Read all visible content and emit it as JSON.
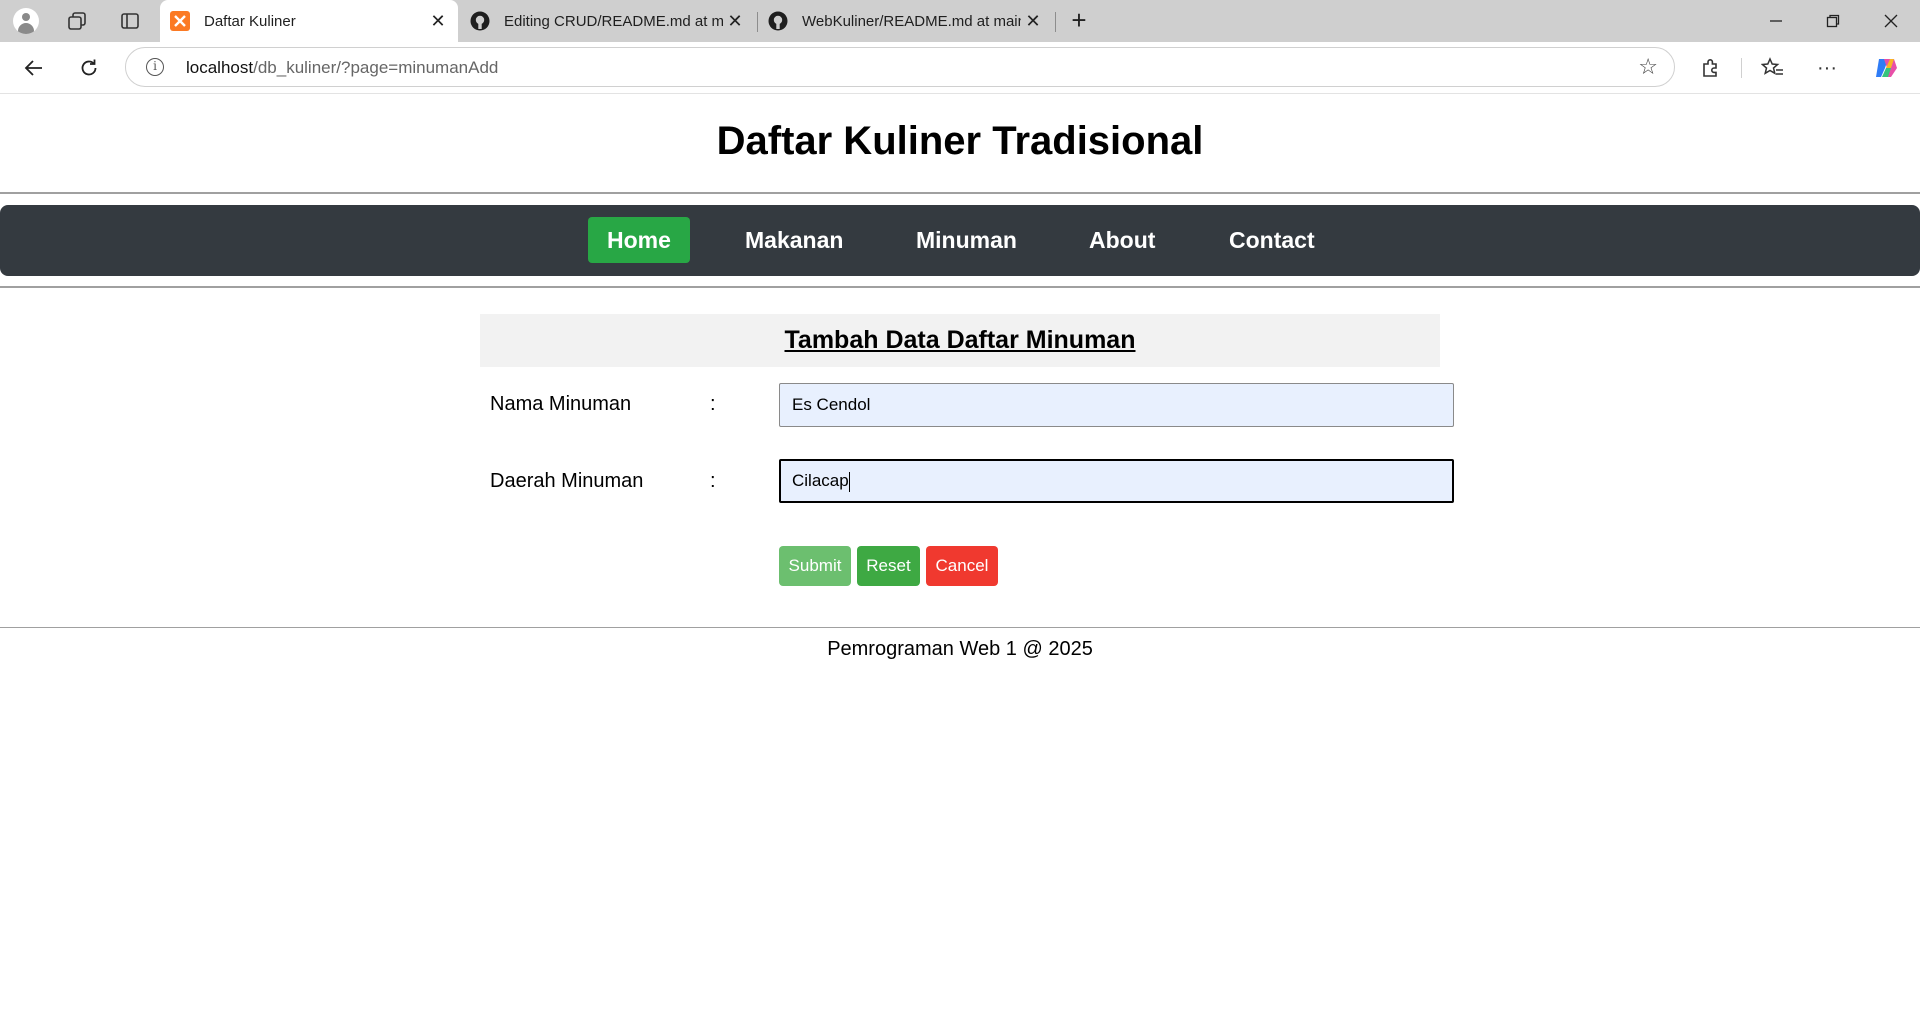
{
  "browser": {
    "tabs": [
      {
        "title": "Daftar Kuliner",
        "active": true,
        "icon": "xampp-icon"
      },
      {
        "title": "Editing CRUD/README.md at main",
        "active": false,
        "icon": "github-icon"
      },
      {
        "title": "WebKuliner/README.md at main",
        "active": false,
        "icon": "github-icon"
      }
    ],
    "url_host": "localhost",
    "url_path": "/db_kuliner/?page=minumanAdd"
  },
  "site": {
    "title": "Daftar Kuliner Tradisional",
    "nav": [
      {
        "label": "Home",
        "active": true
      },
      {
        "label": "Makanan",
        "active": false
      },
      {
        "label": "Minuman",
        "active": false
      },
      {
        "label": "About",
        "active": false
      },
      {
        "label": "Contact",
        "active": false
      }
    ]
  },
  "form": {
    "heading": "Tambah Data Daftar Minuman",
    "separator": ":",
    "fields": [
      {
        "label": "Nama Minuman",
        "value": "Es Cendol"
      },
      {
        "label": "Daerah Minuman",
        "value": "Cilacap"
      }
    ],
    "buttons": {
      "submit": "Submit",
      "reset": "Reset",
      "cancel": "Cancel"
    }
  },
  "footer": {
    "text": "Pemrograman Web 1 @ 2025"
  },
  "colors": {
    "nav_bg": "#343a40",
    "nav_active": "#28a745",
    "submit": "#6cbf6f",
    "reset": "#3ea943",
    "cancel": "#f0392f",
    "input_bg": "#e8f0fe"
  }
}
